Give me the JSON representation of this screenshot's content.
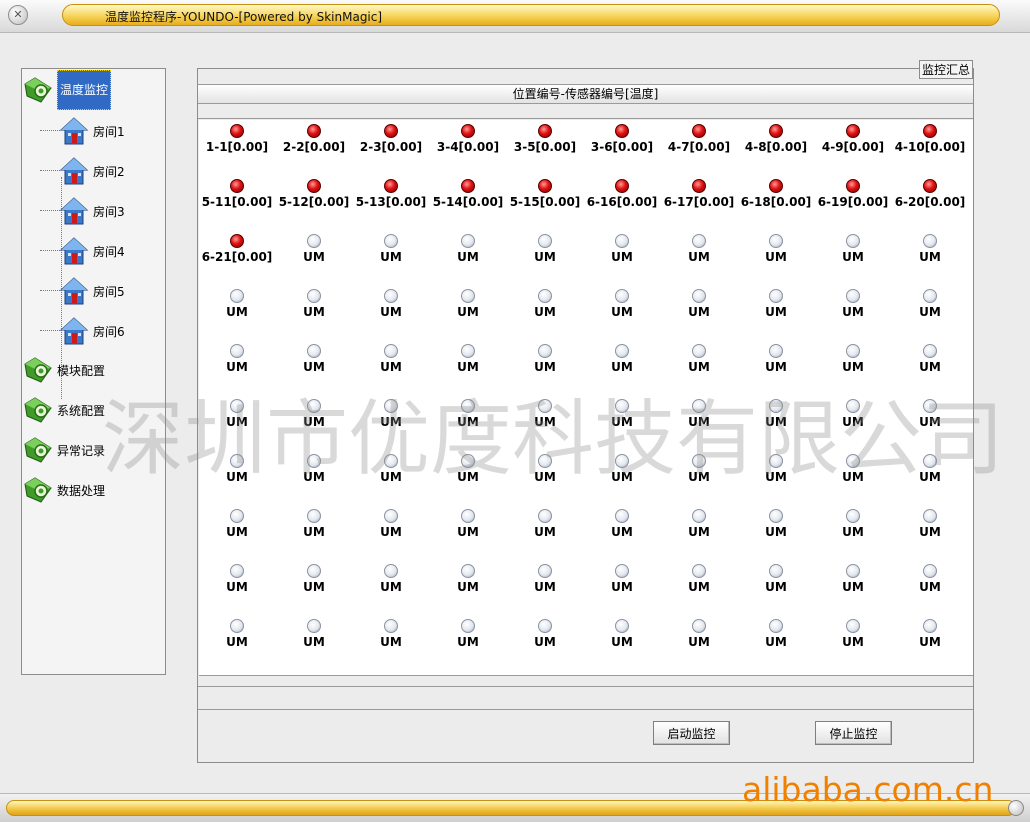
{
  "window": {
    "title": "温度监控程序-YOUNDO-[Powered by SkinMagic]",
    "system_icon": "close-circle-icon"
  },
  "tree": {
    "roots": [
      {
        "label": "温度监控",
        "icon": "gear-icon",
        "selected": true
      },
      {
        "label": "模块配置",
        "icon": "gear-icon",
        "selected": false
      },
      {
        "label": "系统配置",
        "icon": "gear-icon",
        "selected": false
      },
      {
        "label": "异常记录",
        "icon": "gear-icon",
        "selected": false
      },
      {
        "label": "数据处理",
        "icon": "gear-icon",
        "selected": false
      }
    ],
    "children": [
      {
        "label": "房间1",
        "icon": "house-icon"
      },
      {
        "label": "房间2",
        "icon": "house-icon"
      },
      {
        "label": "房间3",
        "icon": "house-icon"
      },
      {
        "label": "房间4",
        "icon": "house-icon"
      },
      {
        "label": "房间5",
        "icon": "house-icon"
      },
      {
        "label": "房间6",
        "icon": "house-icon"
      }
    ]
  },
  "panel": {
    "summary_label": "监控汇总",
    "header": "位置编号-传感器编号[温度]"
  },
  "sensors": {
    "columns": 10,
    "active": [
      "1-1[0.00]",
      "2-2[0.00]",
      "2-3[0.00]",
      "3-4[0.00]",
      "3-5[0.00]",
      "3-6[0.00]",
      "4-7[0.00]",
      "4-8[0.00]",
      "4-9[0.00]",
      "4-10[0.00]",
      "5-11[0.00]",
      "5-12[0.00]",
      "5-13[0.00]",
      "5-14[0.00]",
      "5-15[0.00]",
      "6-16[0.00]",
      "6-17[0.00]",
      "6-18[0.00]",
      "6-19[0.00]",
      "6-20[0.00]",
      "6-21[0.00]"
    ],
    "unmapped_label": "UM",
    "unmapped_count": 79,
    "active_color": "#e01010",
    "inactive_color": "#e4e8ef"
  },
  "buttons": {
    "start": "启动监控",
    "stop": "停止监控"
  },
  "watermark": "深圳市优度科技有限公司",
  "footer_watermark": "alibaba.com.cn",
  "colors": {
    "selection": "#316ac5",
    "title_gold": "#f7d35a",
    "watermark_orange": "#f08000"
  }
}
